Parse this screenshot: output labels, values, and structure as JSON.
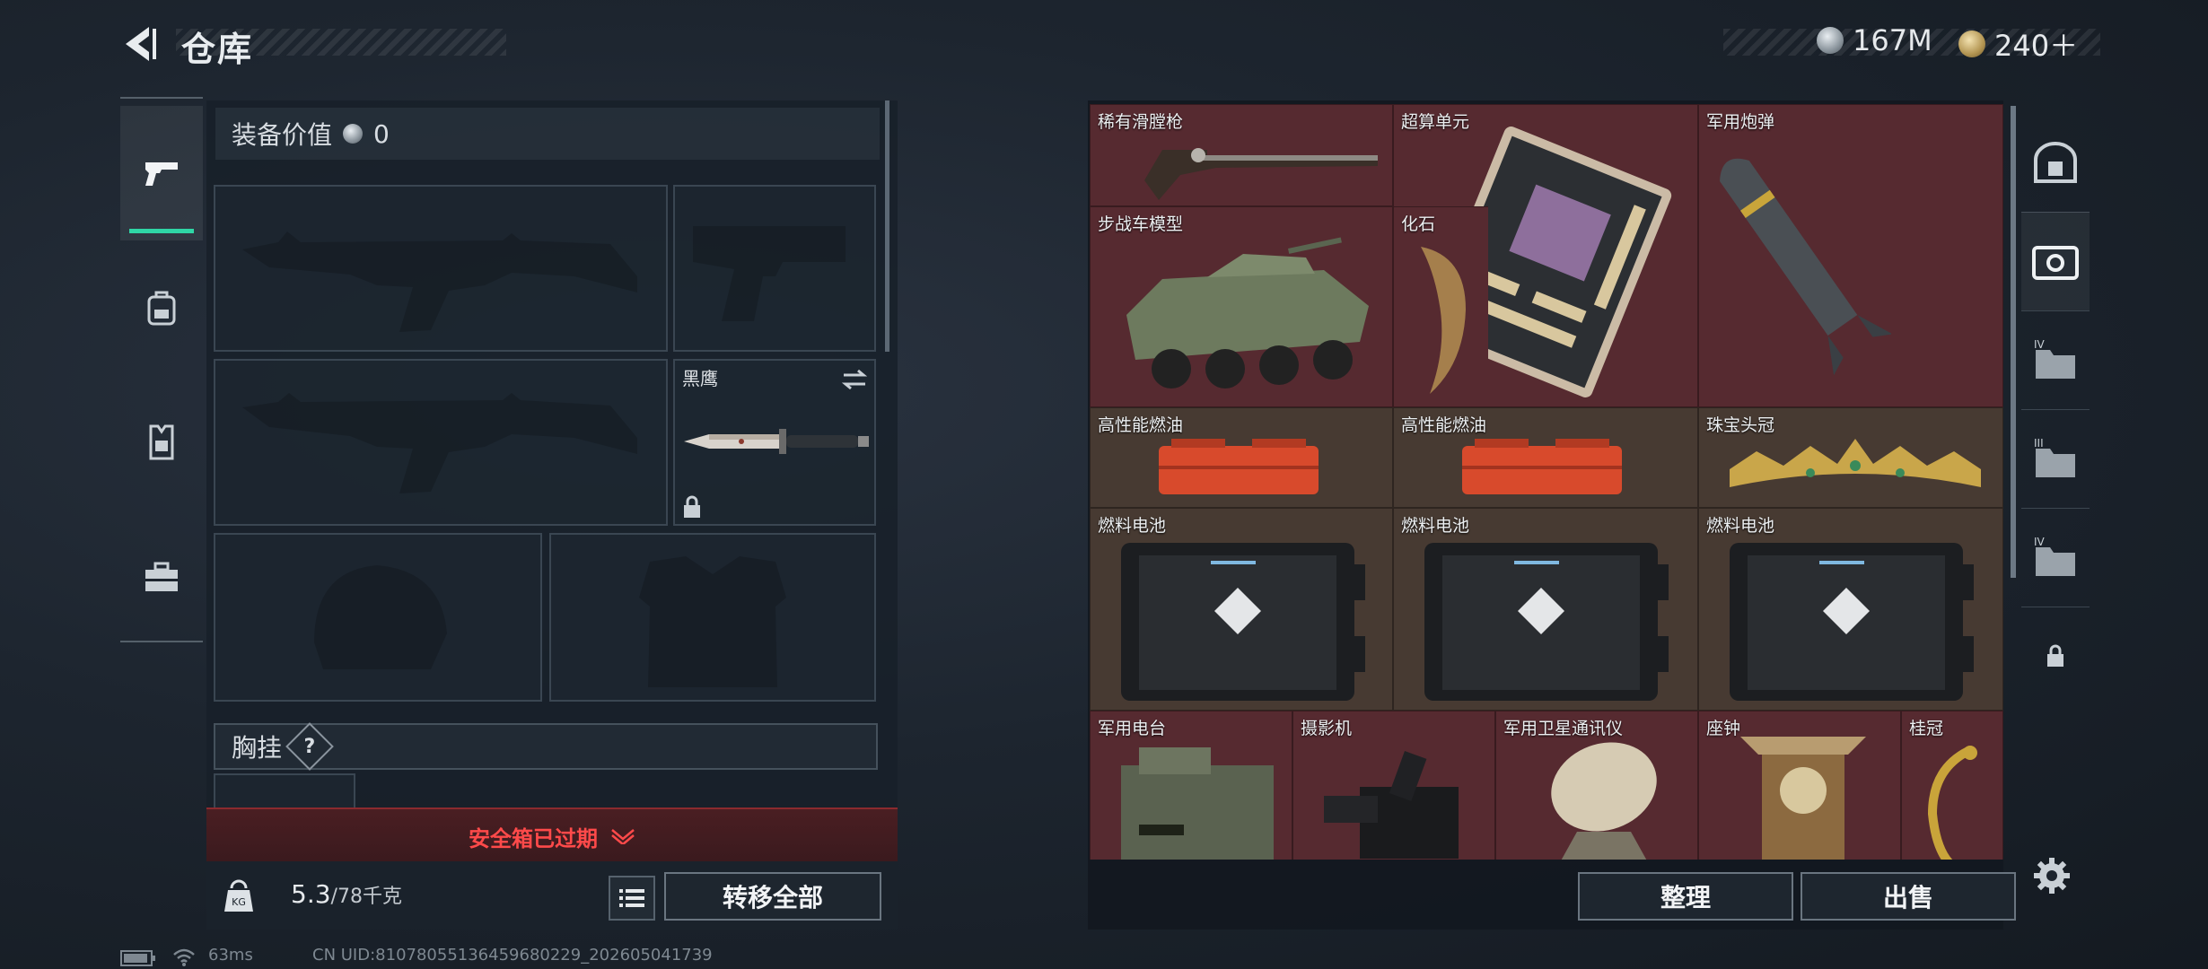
{
  "header": {
    "title": "仓库",
    "currency_silver": "167M",
    "currency_gold": "240＋"
  },
  "left_nav": {
    "items": [
      {
        "icon": "pistol-icon",
        "active": true
      },
      {
        "icon": "backpack-icon",
        "active": false
      },
      {
        "icon": "vest-icon",
        "active": false
      },
      {
        "icon": "toolbox-icon",
        "active": false
      }
    ]
  },
  "equipment": {
    "value_label": "装备价值",
    "value": "0",
    "melee_label": "黑鹰",
    "chest_rig_label": "胸挂",
    "help_label": "?",
    "safebox_status": "安全箱已过期",
    "weight_current": "5.3",
    "weight_max": "/78千克",
    "transfer_all": "转移全部"
  },
  "stash": {
    "items": [
      {
        "name": "稀有滑膛枪",
        "color": "red"
      },
      {
        "name": "超算单元",
        "color": "red"
      },
      {
        "name": "军用炮弹",
        "color": "red"
      },
      {
        "name": "步战车模型",
        "color": "red"
      },
      {
        "name": "化石",
        "color": "red"
      },
      {
        "name": "高性能燃油",
        "color": "brown"
      },
      {
        "name": "高性能燃油",
        "color": "brown"
      },
      {
        "name": "珠宝头冠",
        "color": "brown"
      },
      {
        "name": "燃料电池",
        "color": "brown"
      },
      {
        "name": "燃料电池",
        "color": "brown"
      },
      {
        "name": "燃料电池",
        "color": "brown"
      },
      {
        "name": "军用电台",
        "color": "red"
      },
      {
        "name": "摄影机",
        "color": "red"
      },
      {
        "name": "军用卫星通讯仪",
        "color": "red"
      },
      {
        "name": "座钟",
        "color": "red"
      },
      {
        "name": "桂冠",
        "color": "red"
      }
    ],
    "sort_label": "整理",
    "sell_label": "出售"
  },
  "right_nav": {
    "items": [
      {
        "icon": "vault-icon",
        "label": ""
      },
      {
        "icon": "stash-bag-icon",
        "label": ""
      },
      {
        "icon": "folder-iv-icon",
        "label": "IV"
      },
      {
        "icon": "folder-iii-icon",
        "label": "III"
      },
      {
        "icon": "folder-iv-icon",
        "label": "IV"
      },
      {
        "icon": "lock-icon",
        "label": ""
      }
    ]
  },
  "status_bar": {
    "ping": "63ms",
    "uid": "CN UID:810780551364596802​29_202605041739"
  },
  "colors": {
    "accent": "#2fd6a6",
    "red_cell": "#562a30",
    "gold_cell": "#473a32",
    "alert": "#ff4a4a"
  }
}
